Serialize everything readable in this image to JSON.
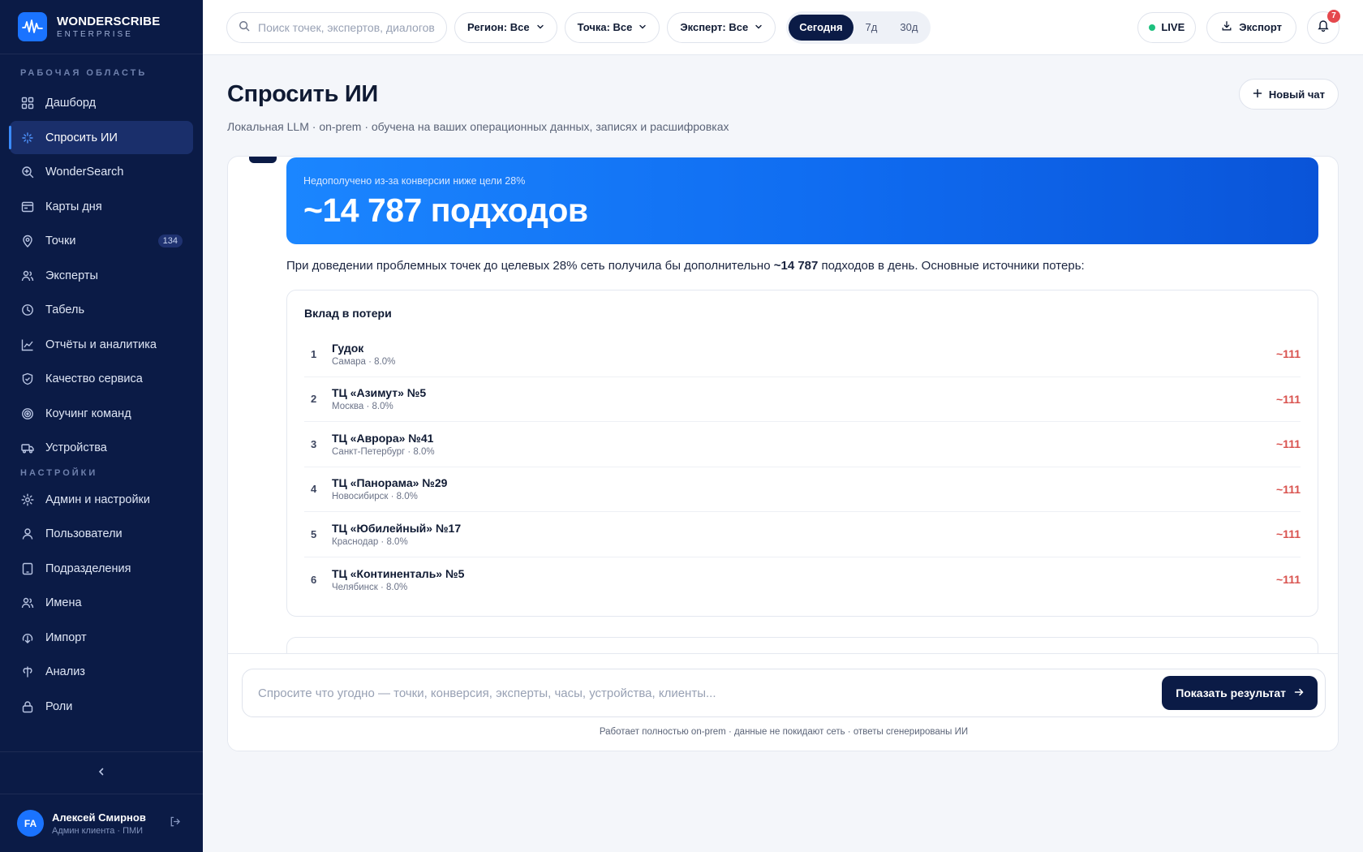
{
  "brand": {
    "name": "WONDERSCRIBE",
    "sub": "ENTERPRISE"
  },
  "sidebar": {
    "workspace_label": "РАБОЧАЯ ОБЛАСТЬ",
    "workspace_items": [
      {
        "label": "Дашборд",
        "icon": "grid-icon"
      },
      {
        "label": "Спросить ИИ",
        "icon": "sparkle-icon",
        "active": true
      },
      {
        "label": "WonderSearch",
        "icon": "search-icon"
      },
      {
        "label": "Карты дня",
        "icon": "card-icon"
      },
      {
        "label": "Точки",
        "icon": "map-pin-icon",
        "badge": "134"
      },
      {
        "label": "Эксперты",
        "icon": "users-icon"
      },
      {
        "label": "Табель",
        "icon": "clock-icon"
      },
      {
        "label": "Отчёты и аналитика",
        "icon": "chart-icon"
      },
      {
        "label": "Качество сервиса",
        "icon": "shield-icon"
      },
      {
        "label": "Коучинг команд",
        "icon": "target-icon"
      },
      {
        "label": "Устройства",
        "icon": "truck-icon"
      }
    ],
    "settings_label": "НАСТРОЙКИ",
    "settings_items": [
      {
        "label": "Админ и настройки",
        "icon": "gear-icon"
      },
      {
        "label": "Пользователи",
        "icon": "user-icon"
      },
      {
        "label": "Подразделения",
        "icon": "tablet-icon"
      },
      {
        "label": "Имена",
        "icon": "users-icon"
      },
      {
        "label": "Импорт",
        "icon": "import-icon"
      },
      {
        "label": "Анализ",
        "icon": "analysis-icon"
      },
      {
        "label": "Роли",
        "icon": "lock-icon"
      }
    ]
  },
  "user": {
    "initials": "FA",
    "name": "Алексей Смирнов",
    "role": "Админ клиента · ПМИ"
  },
  "topbar": {
    "search_placeholder": "Поиск точек, экспертов, диалогов",
    "filters": {
      "region": "Регион: Все",
      "point": "Точка: Все",
      "expert": "Эксперт: Все"
    },
    "periods": [
      "Сегодня",
      "7д",
      "30д"
    ],
    "active_period": "Сегодня",
    "live_label": "LIVE",
    "export_label": "Экспорт",
    "notifications": "7"
  },
  "main": {
    "title": "Спросить ИИ",
    "subtitle": "Локальная LLM · on-prem · обучена на ваших операционных данных, записях и расшифровках",
    "new_chat_label": "Новый чат",
    "hero": {
      "sub": "Недополучено из-за конверсии ниже цели 28%",
      "value": "~14 787 подходов"
    },
    "lead": {
      "before": "При доведении проблемных точек до целевых 28% сеть получила бы дополнительно ",
      "bold": "~14 787",
      "after": " подходов в день. Основные источники потерь:"
    },
    "losses_title": "Вклад в потери",
    "losses": [
      {
        "rank": "1",
        "name": "Гудок",
        "meta": "Самара · 8.0%",
        "value": "~111"
      },
      {
        "rank": "2",
        "name": "ТЦ «Азимут» №5",
        "meta": "Москва · 8.0%",
        "value": "~111"
      },
      {
        "rank": "3",
        "name": "ТЦ «Аврора» №41",
        "meta": "Санкт-Петербург · 8.0%",
        "value": "~111"
      },
      {
        "rank": "4",
        "name": "ТЦ «Панорама» №29",
        "meta": "Новосибирск · 8.0%",
        "value": "~111"
      },
      {
        "rank": "5",
        "name": "ТЦ «Юбилейный» №17",
        "meta": "Краснодар · 8.0%",
        "value": "~111"
      },
      {
        "rank": "6",
        "name": "ТЦ «Континенталь» №5",
        "meta": "Челябинск · 8.0%",
        "value": "~111"
      }
    ],
    "composer_placeholder": "Спросите что угодно — точки, конверсия, эксперты, часы, устройства, клиенты...",
    "send_label": "Показать результат",
    "footnote": "Работает полностью on-prem · данные не покидают сеть · ответы сгенерированы ИИ"
  }
}
